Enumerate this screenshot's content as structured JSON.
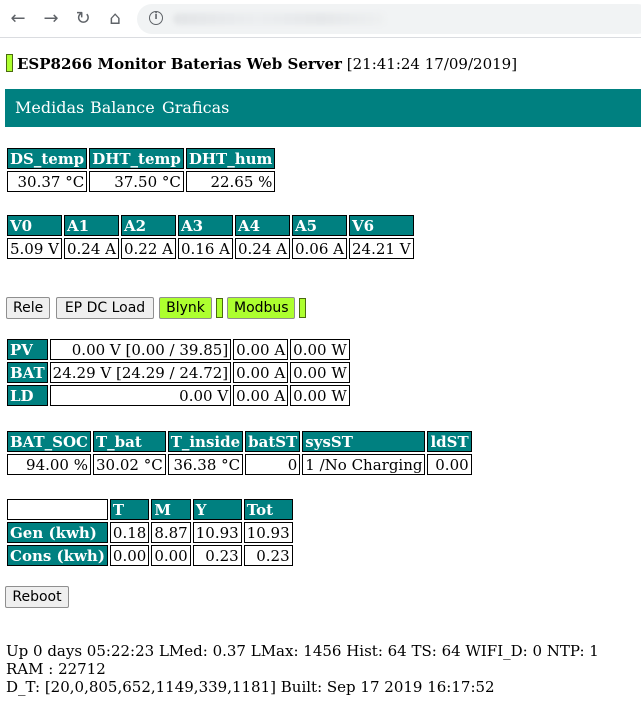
{
  "browser": {
    "back_icon": "←",
    "forward_icon": "→",
    "reload_icon": "↻",
    "home_icon": "⌂",
    "info_icon": "i"
  },
  "header": {
    "title": "ESP8266 Monitor Baterias Web Server",
    "timestamp": "[21:41:24 17/09/2019]"
  },
  "nav": {
    "items": [
      "Medidas",
      "Balance",
      "Graficas"
    ]
  },
  "temps": {
    "headers": [
      "DS_temp",
      "DHT_temp",
      "DHT_hum"
    ],
    "values": [
      "30.37 °C",
      "37.50 °C",
      "22.65 %"
    ]
  },
  "voltages": {
    "headers": [
      "V0",
      "A1",
      "A2",
      "A3",
      "A4",
      "A5",
      "V6"
    ],
    "values": [
      "5.09 V",
      "0.24 A",
      "0.22 A",
      "0.16 A",
      "0.24 A",
      "0.06 A",
      "24.21 V"
    ]
  },
  "buttons": {
    "rele": "Rele",
    "ep_dc_load": "EP DC Load",
    "blynk": "Blynk",
    "modbus": "Modbus",
    "reboot": "Reboot"
  },
  "power": {
    "rows": [
      {
        "label": "PV",
        "voltage": "0.00 V [0.00 / 39.85]",
        "current": "0.00 A",
        "power": "0.00 W"
      },
      {
        "label": "BAT",
        "voltage": "24.29 V [24.29 / 24.72]",
        "current": "0.00 A",
        "power": "0.00 W"
      },
      {
        "label": "LD",
        "voltage": "0.00 V",
        "current": "0.00 A",
        "power": "0.00 W"
      }
    ]
  },
  "battery": {
    "headers": [
      "BAT_SOC",
      "T_bat",
      "T_inside",
      "batST",
      "sysST",
      "ldST"
    ],
    "values": [
      "94.00 %",
      "30.02 °C",
      "36.38 °C",
      "0",
      "1 /No Charging",
      "0.00"
    ]
  },
  "energy": {
    "headers": [
      "",
      "T",
      "M",
      "Y",
      "Tot"
    ],
    "rows": [
      {
        "label": "Gen (kwh)",
        "values": [
          "0.18",
          "8.87",
          "10.93",
          "10.93"
        ]
      },
      {
        "label": "Cons (kwh)",
        "values": [
          "0.00",
          "0.00",
          "0.23",
          "0.23"
        ]
      }
    ]
  },
  "status": {
    "line1": "Up 0 days 05:22:23 LMed: 0.37 LMax: 1456 Hist: 64 TS: 64 WIFI_D: 0 NTP: 1 RAM : 22712",
    "line2": "D_T: [20,0,805,652,1149,339,1181] Built: Sep 17 2019 16:17:52"
  },
  "colors": {
    "teal": "#008080",
    "led_green": "#adff2f"
  }
}
